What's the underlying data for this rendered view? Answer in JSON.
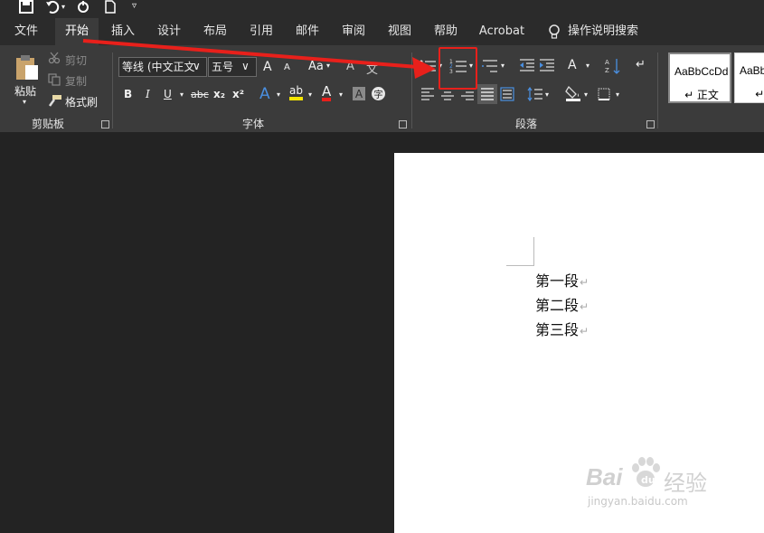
{
  "qat": {
    "save": "save-icon",
    "undo": "undo-icon",
    "redo": "redo-icon",
    "new": "new-doc-icon",
    "customize": "customize-icon"
  },
  "tabs": [
    {
      "label": "文件"
    },
    {
      "label": "开始"
    },
    {
      "label": "插入"
    },
    {
      "label": "设计"
    },
    {
      "label": "布局"
    },
    {
      "label": "引用"
    },
    {
      "label": "邮件"
    },
    {
      "label": "审阅"
    },
    {
      "label": "视图"
    },
    {
      "label": "帮助"
    },
    {
      "label": "Acrobat"
    },
    {
      "label": "操作说明搜索"
    }
  ],
  "clipboard": {
    "paste": "粘贴",
    "cut": "剪切",
    "copy": "复制",
    "format_painter": "格式刷",
    "group": "剪贴板"
  },
  "font": {
    "name": "等线 (中文正文",
    "size": "五号",
    "grow": "A",
    "shrink": "A",
    "case": "Aa",
    "group": "字体",
    "bold": "B",
    "italic": "I",
    "underline": "U",
    "strike": "abc",
    "sub": "x₂",
    "sup": "x²",
    "effects": "A",
    "highlight": "ab",
    "color": "A",
    "shade": "A",
    "enclose": "字"
  },
  "paragraph": {
    "group": "段落"
  },
  "styles": [
    {
      "sample": "AaBbCcDd",
      "name": "↵ 正文"
    },
    {
      "sample": "AaBb",
      "name": "↵ 无"
    }
  ],
  "document": {
    "paragraphs": [
      "第一段",
      "第二段",
      "第三段"
    ],
    "mark": "↵"
  },
  "watermark": {
    "brand": "Bai",
    "brand2": "经验",
    "url": "jingyan.baidu.com"
  },
  "colors": {
    "accent_red": "#e8201b",
    "ribbon": "#3b3b3b",
    "titlebar": "#2b2b2b"
  }
}
